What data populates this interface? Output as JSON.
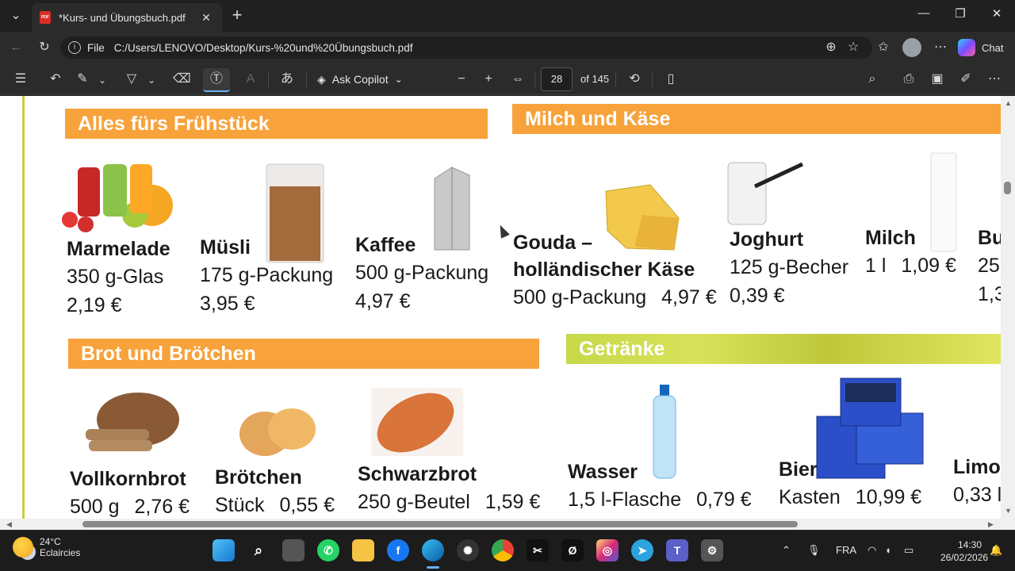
{
  "browser": {
    "tab_title": "*Kurs- und Übungsbuch.pdf",
    "file_label": "File",
    "url": "C:/Users/LENOVO/Desktop/Kurs-%20und%20Übungsbuch.pdf",
    "chat_label": "Chat"
  },
  "pdf_toolbar": {
    "ask_copilot": "Ask Copilot",
    "page_number": "28",
    "page_of": "of 145"
  },
  "document": {
    "sections": {
      "breakfast": "Alles fürs Frühstück",
      "dairy": "Milch und Käse",
      "bread": "Brot und Brötchen",
      "drinks": "Getränke"
    },
    "products": {
      "marmelade": {
        "name": "Marmelade",
        "size": "350 g-Glas",
        "price": "2,19 €"
      },
      "muesli": {
        "name": "Müsli",
        "size": "175 g-Packung",
        "price": "3,95 €"
      },
      "kaffee": {
        "name": "Kaffee",
        "size": "500 g-Packung",
        "price": "4,97 €"
      },
      "gouda": {
        "name1": "Gouda –",
        "name2": "holländischer Käse",
        "size": "500 g-Packung",
        "price": "4,97 €"
      },
      "joghurt": {
        "name": "Joghurt",
        "size": "125 g-Becher",
        "price": "0,39 €"
      },
      "milch": {
        "name": "Milch",
        "size": "1 l",
        "price": "1,09 €"
      },
      "butter_partial": {
        "name": "Bu",
        "size": "25",
        "price": "1,3"
      },
      "vollkornbrot": {
        "name": "Vollkornbrot",
        "size": "500 g",
        "price": "2,76 €"
      },
      "broetchen": {
        "name": "Brötchen",
        "size": "Stück",
        "price": "0,55 €"
      },
      "schwarzbrot": {
        "name": "Schwarzbrot",
        "size": "250 g-Beutel",
        "price": "1,59 €"
      },
      "wasser": {
        "name": "Wasser",
        "size": "1,5 l-Flasche",
        "price": "0,79 €"
      },
      "bier": {
        "name": "Bier",
        "size": "Kasten",
        "price": "10,99 €"
      },
      "limo_partial": {
        "name": "Limo",
        "size": "0,33 l"
      }
    }
  },
  "taskbar": {
    "temperature": "24°C",
    "weather": "Eclaircies",
    "language": "FRA",
    "time": "14:30",
    "date": "26/02/2026"
  },
  "colors": {
    "orange_banner": "#f7a23a",
    "green_banner": "#cdd94a",
    "chrome_dark": "#202020"
  }
}
